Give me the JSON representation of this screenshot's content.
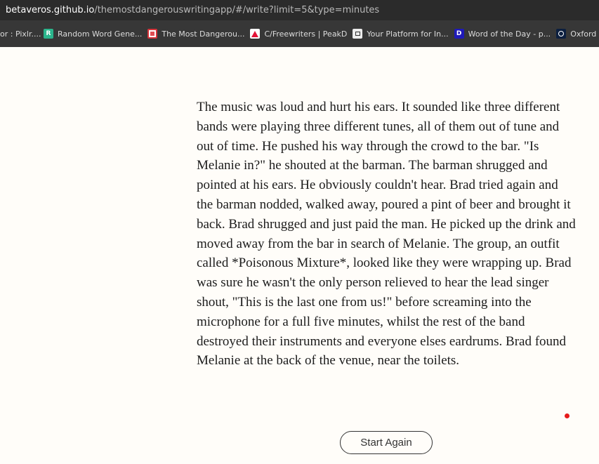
{
  "browser": {
    "url_host": "betaveros.github.io",
    "url_path": "/themostdangerouswritingapp/#/write?limit=5&type=minutes"
  },
  "bookmarks": [
    {
      "label": "or : Pixlr....",
      "icon": "none"
    },
    {
      "label": "Random Word Gene...",
      "icon": "random-word-icon",
      "glyph": "R"
    },
    {
      "label": "The Most Dangerou...",
      "icon": "mdwa-icon"
    },
    {
      "label": "C/Freewriters | PeakD",
      "icon": "peakd-icon"
    },
    {
      "label": "Your Platform for In...",
      "icon": "platform-icon"
    },
    {
      "label": "Word of the Day - p...",
      "icon": "wotd-icon",
      "glyph": "D"
    },
    {
      "label": "Oxford English D",
      "icon": "oed-icon"
    }
  ],
  "story": {
    "text": "The music was loud and hurt his ears. It sounded like three different bands were playing three different tunes, all of them out of tune and out of time. He pushed his way through the crowd to the bar. \"Is Melanie in?\" he shouted at the barman. The barman shrugged and pointed at his ears. He obviously couldn't hear. Brad tried again and the barman nodded, walked away, poured a pint of beer and brought it back. Brad shrugged and just paid the man. He picked up the drink and moved away from the bar in search of Melanie. The group, an outfit called *Poisonous Mixture*, looked like they were wrapping up. Brad was sure he wasn't the only person relieved to hear the lead singer shout, \"This is the last one from us!\" before screaming into the microphone for a full five minutes, whilst the rest of the band destroyed their instruments and everyone elses eardrums. Brad found Melanie at the back of the venue, near the toilets."
  },
  "actions": {
    "start_again_label": "Start Again"
  },
  "colors": {
    "background": "#fffdf9",
    "indicator": "#e61b1b"
  }
}
